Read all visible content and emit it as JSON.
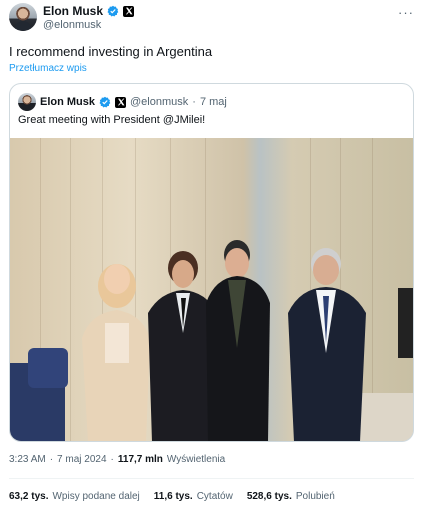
{
  "author": {
    "name": "Elon Musk",
    "handle": "@elonmusk",
    "verified_icon": "verified-badge-icon",
    "affiliation_icon": "x-logo-icon"
  },
  "tweet": {
    "text": "I recommend investing in Argentina",
    "translate_label": "Przetłumacz wpis"
  },
  "quoted": {
    "name": "Elon Musk",
    "handle": "@elonmusk",
    "dot": "·",
    "time": "7 maj",
    "text": "Great meeting with President @JMilei!",
    "image_icon": "group-photo"
  },
  "meta": {
    "time": "3:23 AM",
    "sep1": "·",
    "date": "7 maj 2024",
    "sep2": "·",
    "views_count": "117,7 mln",
    "views_label": "Wyświetlenia"
  },
  "stats": [
    {
      "count": "63,2 tys.",
      "label": "Wpisy podane dalej"
    },
    {
      "count": "11,6 tys.",
      "label": "Cytatów"
    },
    {
      "count": "528,6 tys.",
      "label": "Polubień"
    }
  ],
  "colors": {
    "accent": "#1d9bf0",
    "muted": "#536471",
    "text": "#0f1419",
    "border": "#cfd9de"
  }
}
